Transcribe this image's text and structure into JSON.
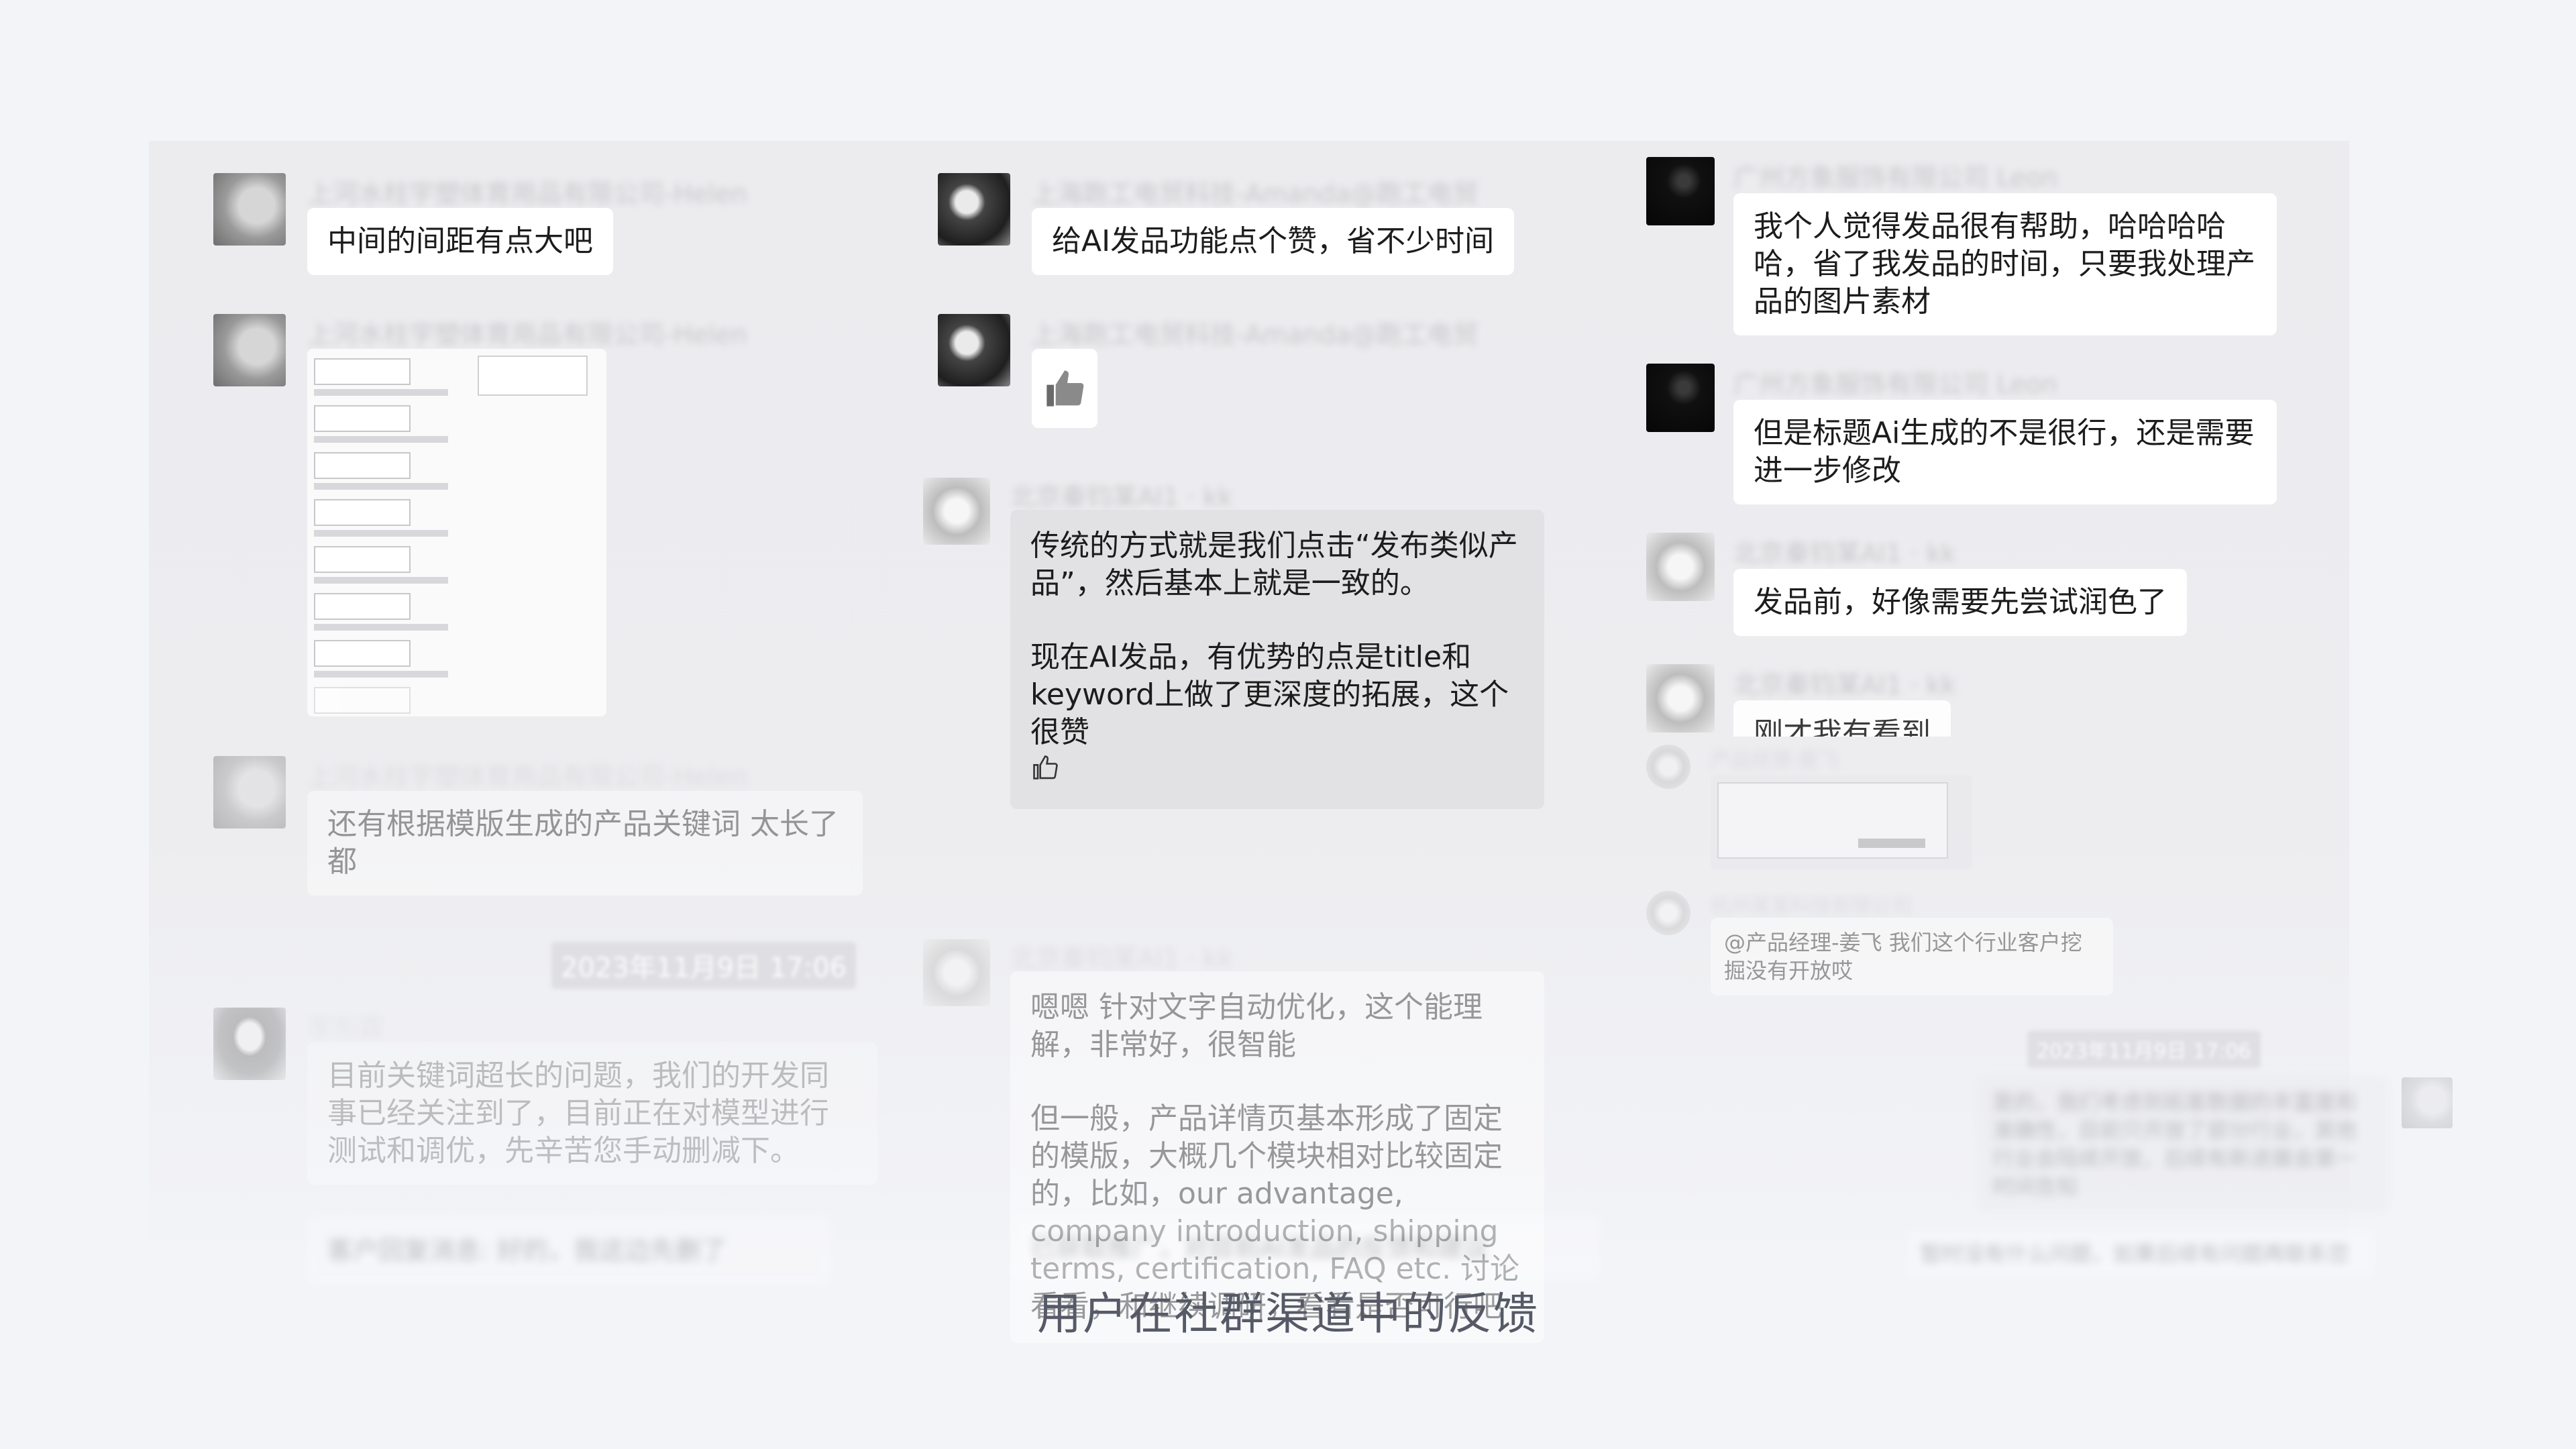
{
  "caption": "用户在社群渠道中的反馈",
  "col1": {
    "sender1": "上河水柱宇塑体育用品有限公司-Helen",
    "msg1": "中间的间距有点大吧",
    "sender2": "上河水柱宇塑体育用品有限公司-Helen",
    "sender3": "上河水柱宇塑体育用品有限公司-Helen",
    "msg3": "还有根据模版生成的产品关键词 太长了都",
    "timestamp": "2023年11月9日 17:06",
    "sender4": "李东霖",
    "msg4": "目前关键词超长的问题，我们的开发同事已经关注到了，目前正在对模型进行测试和调优，先辛苦您手动删减下。",
    "msg5": "客户回复消息: 好的，我这边先删了"
  },
  "col2": {
    "sender1": "上海跑工电贸科技-Amanda@跑工电贸",
    "msg1": "给AI发品功能点个赞，省不少时间",
    "sender2": "上海跑工电贸科技-Amanda@跑工电贸",
    "sender3": "北京秦钧某AI1 · kk",
    "msg3_p1": "传统的方式就是我们点击“发布类似产品”，然后基本上就是一致的。",
    "msg3_p2": "现在AI发品，有优势的点是title和keyword上做了更深度的拓展，这个很赞",
    "sender4": "北京秦钧某AI1 · kk",
    "msg4_p1": "嗯嗯 针对文字自动优化，这个能理解，非常好，很智能",
    "msg4_p2": "但一般，产品详情页基本形成了固定的模版，大概几个模块相对比较固定的，比如，our advantage, company introduction, shipping terms, certification, FAQ etc. 讨论看看，和继续调研，看看是否可行吧",
    "msg5": "已获取推广，对目前AI发品的反馈和建议"
  },
  "col3": {
    "sender1": "广州方象服饰有限公司 Leon",
    "msg1": "我个人觉得发品很有帮助，哈哈哈哈哈，省了我发品的时间，只要我处理产品的图片素材",
    "sender2": "广州方象服饰有限公司 Leon",
    "msg2": "但是标题Ai生成的不是很行，还是需要进一步修改",
    "sender3": "北京秦钧某AI1 · kk",
    "msg3": "发品前，好像需要先尝试润色了",
    "sender4": "北京秦钧某AI1 · kk",
    "msg4": "刚才我有看到",
    "sender5": "产品经理-姜飞",
    "sender6": "杭州某某科技有限公司",
    "msg6": "@产品经理-姜飞 我们这个行业客户挖掘没有开放哎",
    "timestamp": "2023年11月9日 17:06",
    "msg7": "是的，我们考虑到拓客数据的丰富度和准确性，目前只开放了部分行业，其他行业会陆续开放，后续有新进展会第一时间告知",
    "msg8": "暂时没有什么问题，如果后续有问题再联系您"
  },
  "colors": {
    "background": "#f3f4f8",
    "bubble": "#ffffff",
    "bubble_quoted": "#e2e2e4",
    "caption": "#555a66"
  }
}
